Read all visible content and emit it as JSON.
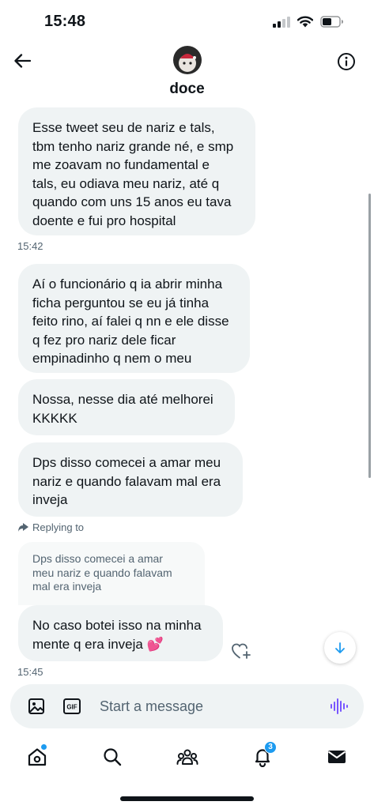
{
  "status_bar": {
    "time": "15:48",
    "icons": [
      "cellular-signal-icon",
      "wifi-icon",
      "battery-icon"
    ]
  },
  "header": {
    "name": "doce",
    "icons": [
      "back-arrow-icon",
      "avatar",
      "info-icon"
    ]
  },
  "conversation": {
    "messages": [
      {
        "text": "Esse tweet seu de nariz e tals,\ntbm tenho nariz grande né, e smp\nme zoavam no fundamental e\ntals, eu odiava meu nariz, até q\nquando com uns 15 anos eu tava\ndoente e fui pro hospital"
      },
      {
        "text": "Aí o funcionário q ia abrir minha\nficha perguntou se eu já tinha\nfeito rino, aí falei q nn e ele disse\nq fez pro nariz dele ficar\nempinadinho q nem o meu"
      },
      {
        "text": "Nossa, nesse dia até melhorei\nKKKKK"
      },
      {
        "text": "Dps disso comecei a amar meu\nnariz e quando falavam mal era\ninveja"
      },
      {
        "text": "No caso botei isso na minha\nmente q era inveja 💕"
      }
    ],
    "timestamps": [
      "15:42",
      "15:45"
    ],
    "reply": {
      "label": "Replying to",
      "quoted_text": "Dps disso comecei a amar\nmeu nariz e quando falavam\nmal era inveja"
    },
    "icons": [
      "reply-arrow-icon",
      "heart-add-icon",
      "scroll-down-arrow-icon"
    ]
  },
  "composer": {
    "placeholder": "Start a message",
    "icons": [
      "image-icon",
      "gif-icon",
      "voice-message-icon"
    ]
  },
  "tabbar": {
    "notifications_count": "3",
    "icons": [
      "home-icon",
      "search-icon",
      "communities-icon",
      "notifications-bell-icon",
      "messages-envelope-icon"
    ]
  },
  "colors": {
    "accent": "#1d9bf0",
    "bubble_bg": "#eff3f4",
    "secondary_text": "#536471",
    "voice_icon": "#7856ff"
  }
}
